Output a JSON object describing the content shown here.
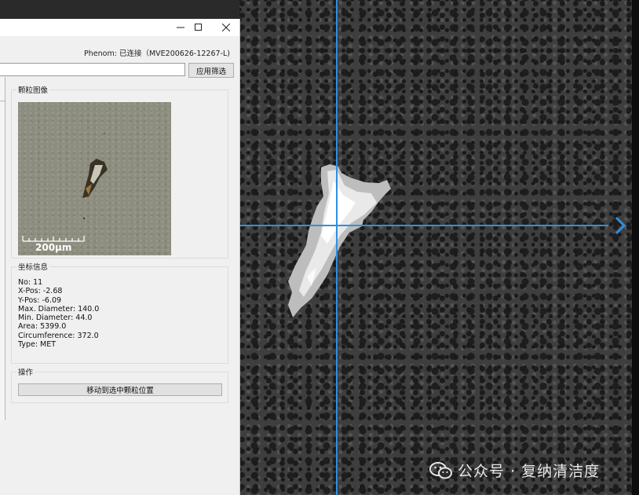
{
  "dialog": {
    "connection_status": "Phenom: 已连接（MVE200626-12267-L)",
    "filter_value": "",
    "apply_filter_label": "应用筛选",
    "particle_image_group": {
      "title": "颗粒图像",
      "scale_label": "200μm"
    },
    "coordinates_group": {
      "title": "坐标信息",
      "lines": [
        "No: 11",
        "X-Pos: -2.68",
        "Y-Pos: -6.09",
        "Max. Diameter: 140.0",
        "Min. Diameter: 44.0",
        "Area: 5399.0",
        "Circumference: 372.0",
        "Type: MET"
      ]
    },
    "operations_group": {
      "title": "操作",
      "move_button_label": "移动到选中颗粒位置"
    }
  },
  "window_controls": {
    "minimize_icon": "minimize-icon",
    "maximize_icon": "maximize-icon",
    "close_icon": "close-icon"
  },
  "live_view": {
    "crosshair_color": "#2f8fe0",
    "nav_icon": "chevron-right-icon"
  },
  "watermark": {
    "text": "公众号 · 复纳清洁度",
    "icon": "wechat-icon"
  }
}
